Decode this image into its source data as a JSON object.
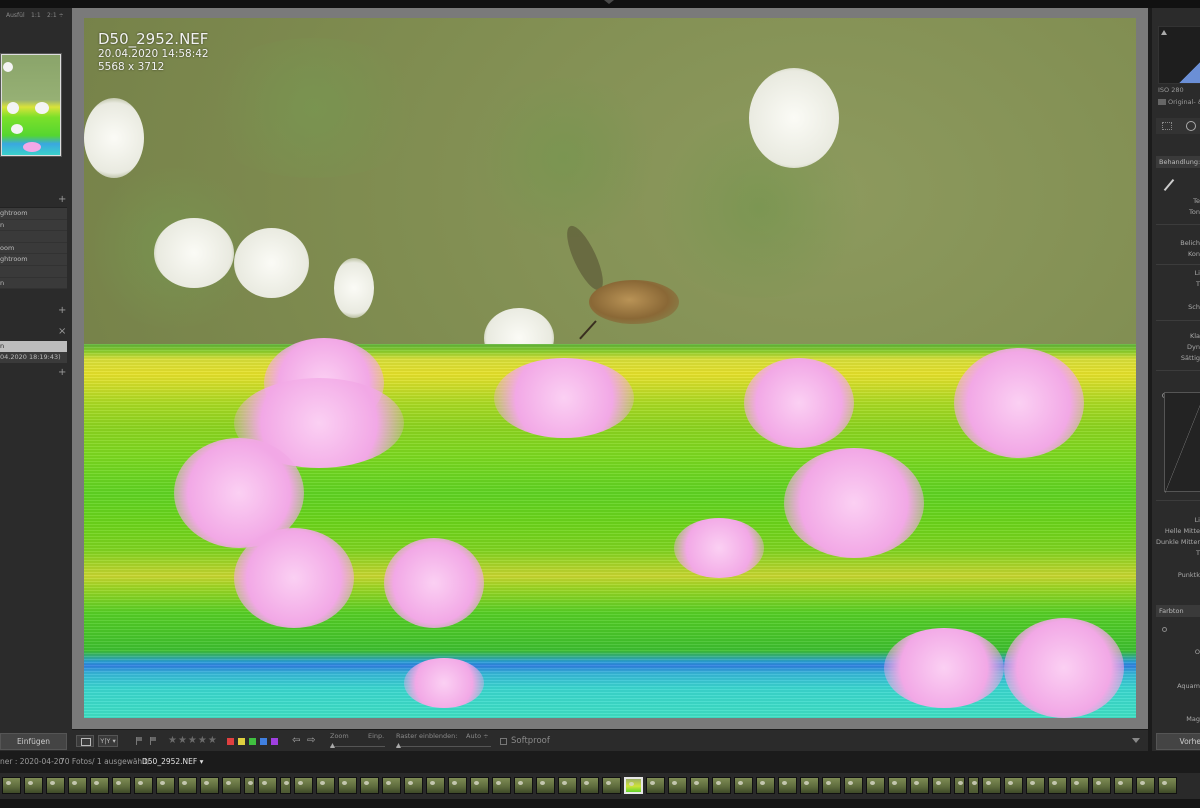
{
  "window": {
    "nav_head": {
      "fit": "Ausfül",
      "one": "1:1",
      "two": "2:1 ÷"
    }
  },
  "left_panel": {
    "collections": [
      "ghtroom",
      "n",
      "",
      "oom",
      "ghtroom",
      "",
      "n"
    ],
    "history_items": [
      "n",
      "04.2020 18:19:43)"
    ],
    "paste_button": "Einfügen"
  },
  "photo": {
    "filename": "D50_2952.NEF",
    "datetime": "20.04.2020 14:58:42",
    "dimensions": "5568 x 3712"
  },
  "toolbar": {
    "view_yy": "Y|Y ▾",
    "stars": "★★★★★",
    "color_labels": [
      "#e04040",
      "#e0d040",
      "#40c040",
      "#4080e0",
      "#a040e0"
    ],
    "prev_arrow": "⇦",
    "next_arrow": "⇨",
    "zoom_label": "Zoom",
    "zoom_value": "Einp.",
    "grid_label": "Raster einblenden:",
    "grid_value": "Auto ÷",
    "softproof_label": "Softproof"
  },
  "right_panel": {
    "iso": "ISO 280",
    "original": "Original- &",
    "treatment": "Behandlung:",
    "tone_labels": [
      "Te",
      "Ton"
    ],
    "light_labels": [
      "Belich",
      "Kon"
    ],
    "presence_labels": [
      "Li",
      "T"
    ],
    "black_label": "Sch",
    "clarity_labels": [
      "Kla",
      "Dyn",
      "Sättig"
    ],
    "curve_labels": [
      "Li",
      "Helle Mitte",
      "Dunkle Mitter",
      "T"
    ],
    "point_label": "Punktk",
    "hue_head": "Farbton",
    "hue_labels": [
      "O",
      "Aquam",
      "Mag"
    ],
    "prev_button": "Vorhe"
  },
  "filmstrip_bar": {
    "path": "ner : 2020-04-20",
    "count": "70 Fotos/ 1 ausgewählt/",
    "file": "D50_2952.NEF ▾"
  }
}
